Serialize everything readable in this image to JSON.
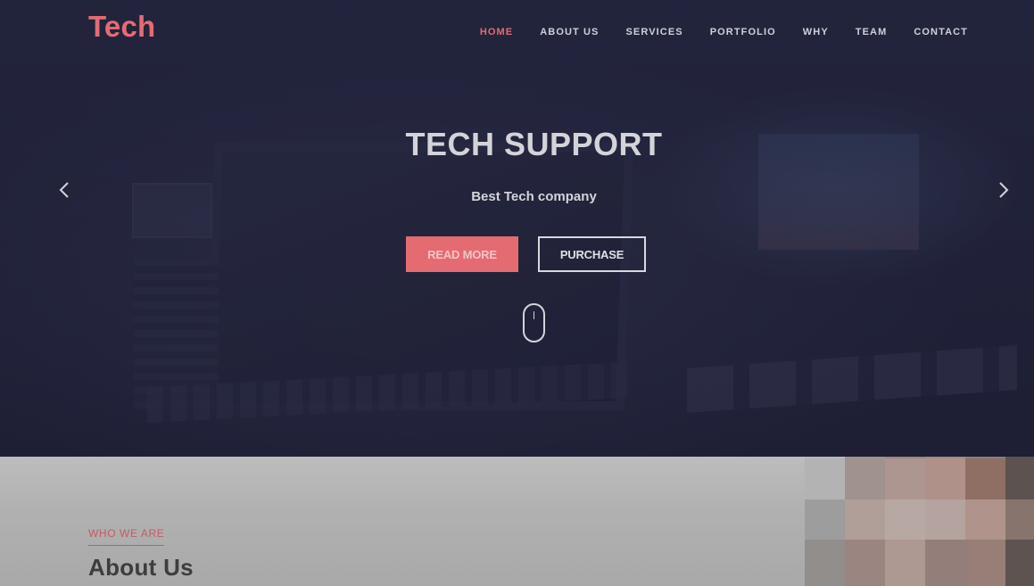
{
  "brand": {
    "logo_text": "Tech",
    "accent_color": "#e56b72"
  },
  "nav": {
    "items": [
      {
        "label": "HOME",
        "active": true
      },
      {
        "label": "ABOUT US",
        "active": false
      },
      {
        "label": "SERVICES",
        "active": false
      },
      {
        "label": "PORTFOLIO",
        "active": false
      },
      {
        "label": "WHY",
        "active": false
      },
      {
        "label": "TEAM",
        "active": false
      },
      {
        "label": "CONTACT",
        "active": false
      }
    ]
  },
  "hero": {
    "title": "TECH SUPPORT",
    "subtitle": "Best Tech company",
    "primary_button": "READ MORE",
    "secondary_button": "PURCHASE",
    "prev_icon": "chevron-left-icon",
    "next_icon": "chevron-right-icon",
    "scroll_icon": "mouse-scroll-icon"
  },
  "about": {
    "eyebrow": "WHO WE ARE",
    "title": "About Us"
  },
  "mosaic_colors": [
    [
      "#b9b9b9",
      "#a0938f",
      "#9b8581",
      "#a28b84",
      "#8e7e79",
      "#5c524f"
    ],
    [
      "#b3b3b3",
      "#a0938f",
      "#ad9690",
      "#b0918a",
      "#8f6f64",
      "#5c524f"
    ],
    [
      "#9d9d9d",
      "#b09e98",
      "#b7a8a4",
      "#b4a39e",
      "#b0938a",
      "#87746d"
    ],
    [
      "#918e8b",
      "#9b8580",
      "#ad9892",
      "#937e79",
      "#977e77",
      "#5e5350"
    ],
    [
      "#918e8b",
      "#9b8580",
      "#ad9892",
      "#937e79",
      "#977e77",
      "#5e5350"
    ]
  ]
}
